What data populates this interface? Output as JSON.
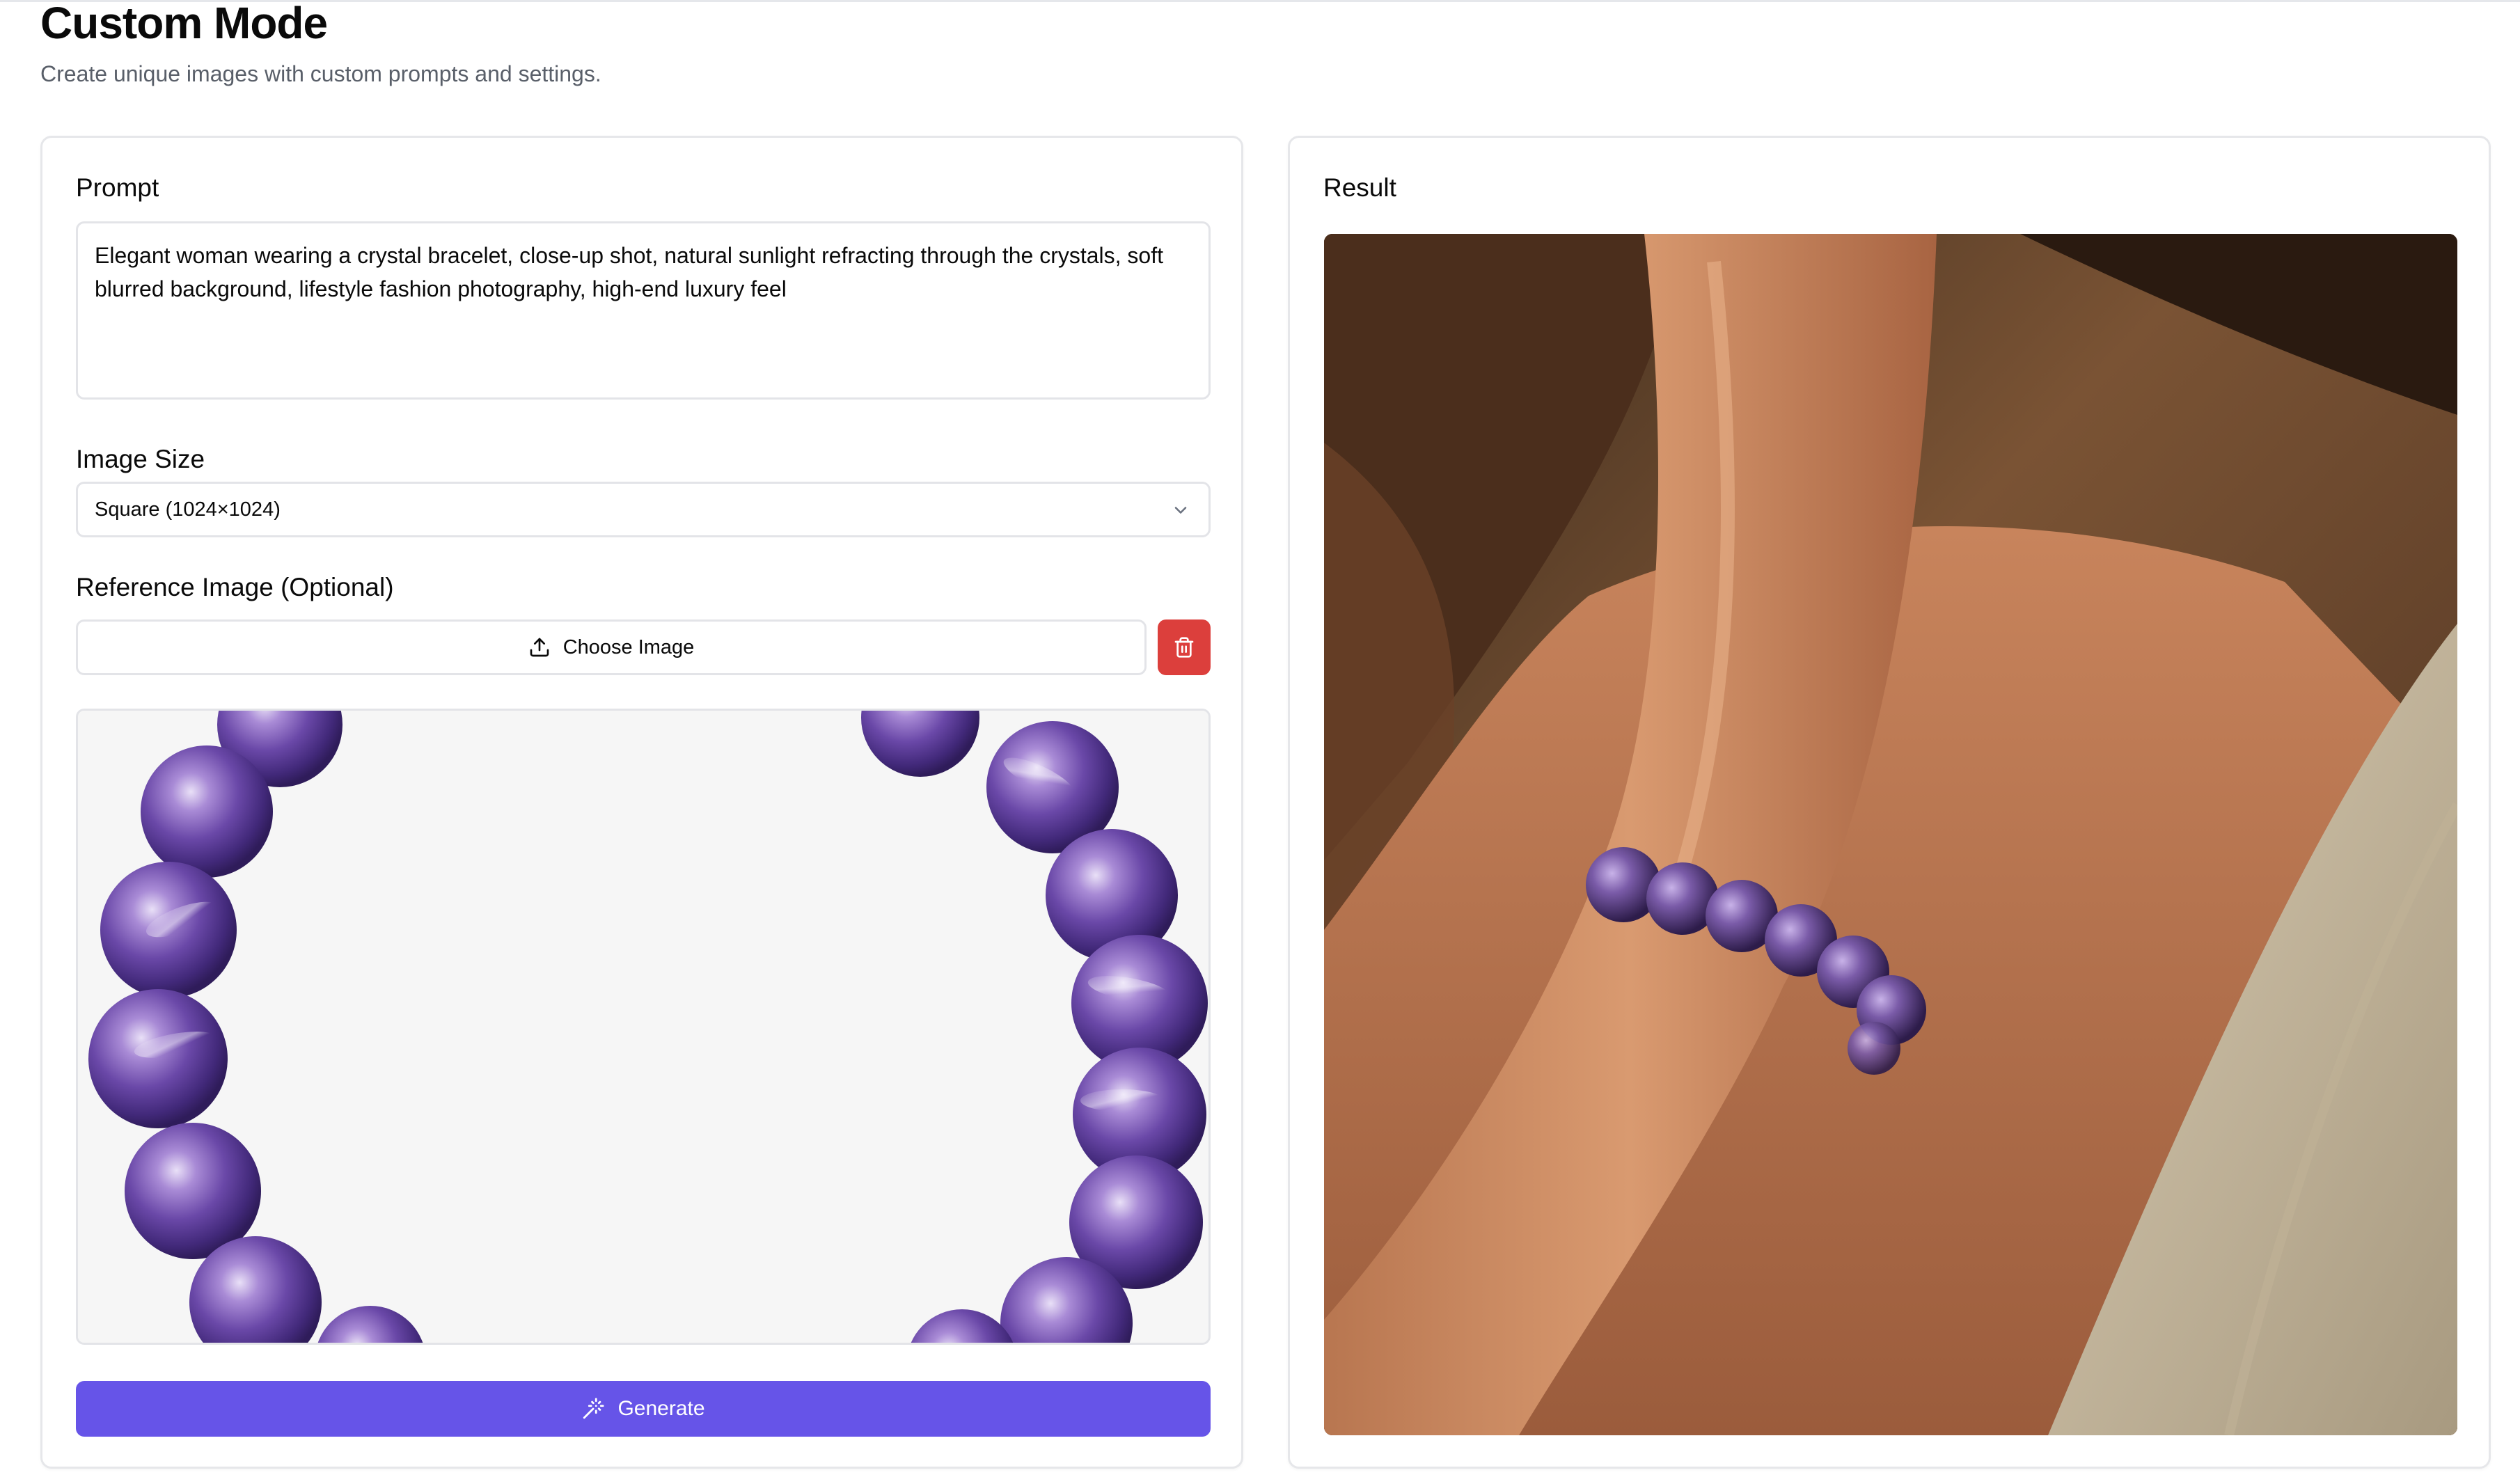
{
  "page": {
    "title": "Custom Mode",
    "subtitle": "Create unique images with custom prompts and settings."
  },
  "form": {
    "prompt_label": "Prompt",
    "prompt_value": "Elegant woman wearing a crystal bracelet, close-up shot, natural sunlight refracting through the crystals, soft blurred background, lifestyle fashion photography, high-end luxury feel",
    "size_label": "Image Size",
    "size_value": "Square (1024×1024)",
    "reference_label": "Reference Image (Optional)",
    "choose_image_label": "Choose Image",
    "generate_label": "Generate"
  },
  "result": {
    "label": "Result"
  },
  "icons": {
    "upload": "upload-icon",
    "trash": "trash-icon",
    "chevron": "chevron-down-icon",
    "wand": "magic-wand-icon"
  },
  "colors": {
    "primary": "#6654e8",
    "danger": "#dc3f3c",
    "border": "#e3e4e8",
    "muted_text": "#595f69"
  }
}
